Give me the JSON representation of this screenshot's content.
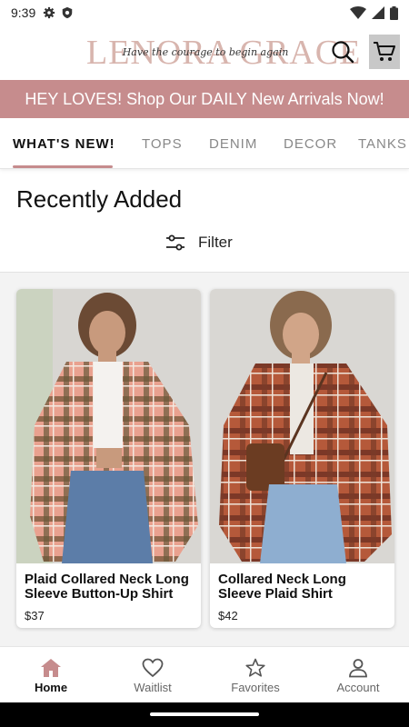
{
  "status_bar": {
    "time": "9:39"
  },
  "header": {
    "logo_text": "LENORA GRACE",
    "logo_tagline": "Have the courage to begin again"
  },
  "promo_banner": {
    "text": "HEY LOVES! Shop Our DAILY New Arrivals Now!"
  },
  "tabs": [
    "WHAT'S NEW!",
    "TOPS",
    "DENIM",
    "DECOR",
    "TANKS"
  ],
  "section": {
    "title": "Recently Added",
    "filter_label": "Filter"
  },
  "products": [
    {
      "name": "Plaid Collared Neck Long Sleeve Button-Up Shirt",
      "price": "$37"
    },
    {
      "name": "Collared Neck Long Sleeve Plaid Shirt",
      "price": "$42"
    }
  ],
  "bottom_nav": [
    {
      "label": "Home",
      "icon": "home-icon"
    },
    {
      "label": "Waitlist",
      "icon": "heart-icon"
    },
    {
      "label": "Favorites",
      "icon": "star-icon"
    },
    {
      "label": "Account",
      "icon": "account-icon"
    }
  ],
  "colors": {
    "accent": "#c68c8d",
    "logo": "#d8b5ae"
  }
}
